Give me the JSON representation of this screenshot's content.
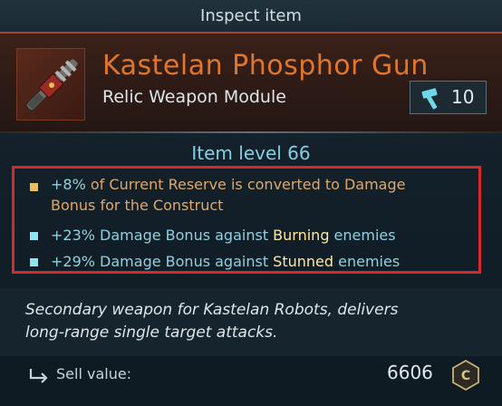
{
  "header": {
    "title": "Inspect item"
  },
  "item": {
    "name": "Kastelan Phosphor Gun",
    "type": "Relic Weapon Module",
    "icon": "phosphor-gun-icon",
    "tier_icon": "hammer-icon",
    "tier_value": "10"
  },
  "item_level": "Item level 66",
  "stats": [
    {
      "bullet_color": "#e8c15a",
      "value": "+8%",
      "line1_rest": " of Current Reserve is converted to Damage",
      "line2": "Bonus for the Construct"
    },
    {
      "bullet_color": "#8fe3f2",
      "value": "+23%",
      "pre": " Damage Bonus against ",
      "keyword": "Burning",
      "post": " enemies"
    },
    {
      "bullet_color": "#8fe3f2",
      "value": "+29%",
      "pre": " Damage Bonus against ",
      "keyword": "Stunned",
      "post": " enemies"
    }
  ],
  "description": {
    "line1": "Secondary weapon for Kastelan Robots, delivers",
    "line2": "long-range single target attacks."
  },
  "footer": {
    "sell_label": "Sell value:",
    "sell_value": "6606",
    "sell_icon": "return-arrow-icon",
    "currency_icon": "requisition-coin-icon"
  },
  "colors": {
    "accent_orange": "#e0762d",
    "highlight_box": "#d7282c",
    "stat_text": "#8fd1e0"
  }
}
